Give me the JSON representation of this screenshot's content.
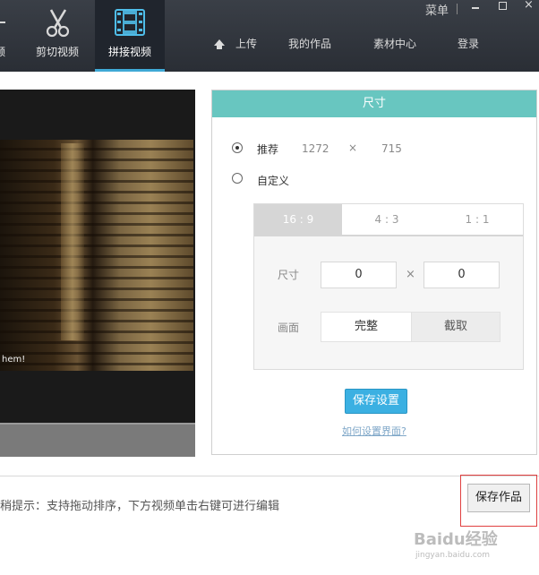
{
  "topbar": {
    "tabs": [
      {
        "id": "left",
        "label": "频",
        "icon": "plus-icon"
      },
      {
        "id": "cut",
        "label": "剪切视频",
        "icon": "scissors-icon"
      },
      {
        "id": "join",
        "label": "拼接视频",
        "icon": "film-strip-icon",
        "active": true
      }
    ],
    "nav": {
      "upload": "上传",
      "my_works": "我的作品",
      "materials": "素材中心",
      "login": "登录"
    },
    "menu_label": "菜单",
    "accent_color": "#3fa9d6"
  },
  "video": {
    "subtitle": "hem!"
  },
  "size_panel": {
    "title": "尺寸",
    "header_color": "#68c6c0",
    "recommended": {
      "label": "推荐",
      "width": "1272",
      "x": "×",
      "height": "715",
      "selected": true
    },
    "custom": {
      "label": "自定义",
      "selected": false
    },
    "ratios": [
      {
        "label": "16 : 9",
        "active": true
      },
      {
        "label": "4 : 3",
        "active": false
      },
      {
        "label": "1 : 1",
        "active": false
      }
    ],
    "size_label": "尺寸",
    "size_w": "0",
    "size_x": "×",
    "size_h": "0",
    "canvas_label": "画面",
    "mode_full": "完整",
    "mode_crop": "截取",
    "save_settings": "保存设置",
    "help_link": "如何设置界面?"
  },
  "bottom": {
    "tip": "稍提示：支持拖动排序，下方视频单击右键可进行编辑",
    "save_work": "保存作品"
  },
  "watermark": {
    "brand": "Baidu经验",
    "url": "jingyan.baidu.com"
  }
}
